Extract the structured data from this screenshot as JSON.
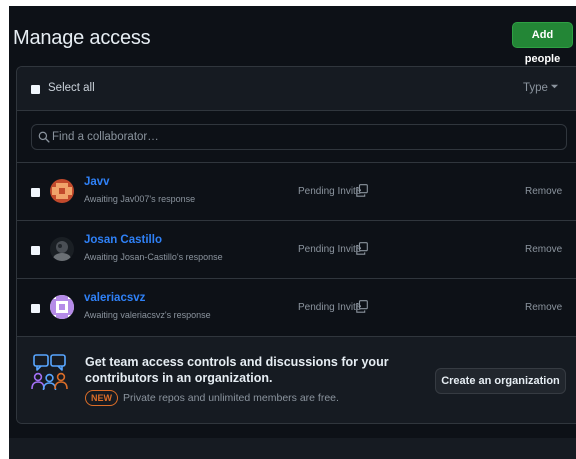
{
  "header": {
    "title": "Manage access",
    "add_button_label": "Add people"
  },
  "toolbar": {
    "select_all_label": "Select all",
    "type_filter_label": "Type",
    "type_filter_icon": "caret-down-icon"
  },
  "search": {
    "placeholder": "Find a collaborator…",
    "value": ""
  },
  "collaborators": [
    {
      "username": "Javv",
      "subtitle": "Awaiting Jav007's response",
      "status": "Pending Invite",
      "action": "Remove",
      "avatar_colors": [
        "#c24a2c",
        "#f0a36a"
      ]
    },
    {
      "username": "Josan Castillo",
      "subtitle": "Awaiting Josan-Castillo's response",
      "status": "Pending Invite",
      "action": "Remove",
      "avatar_colors": [
        "#1a1f24",
        "#6b7075"
      ]
    },
    {
      "username": "valeriacsvz",
      "subtitle": "Awaiting valeriacsvz's response",
      "status": "Pending Invite",
      "action": "Remove",
      "avatar_colors": [
        "#b58be8",
        "#ffffff"
      ]
    }
  ],
  "promo": {
    "text": "Get team access controls and discussions for your contributors in an organization.",
    "badge": "NEW",
    "subtext": "Private repos and unlimited members are free.",
    "button_label": "Create an organization",
    "icon": "team-icon"
  },
  "colors": {
    "background": "#0d1117",
    "accent_green": "#238636",
    "link_blue": "#2f81f7",
    "badge_orange": "#db6d28"
  }
}
